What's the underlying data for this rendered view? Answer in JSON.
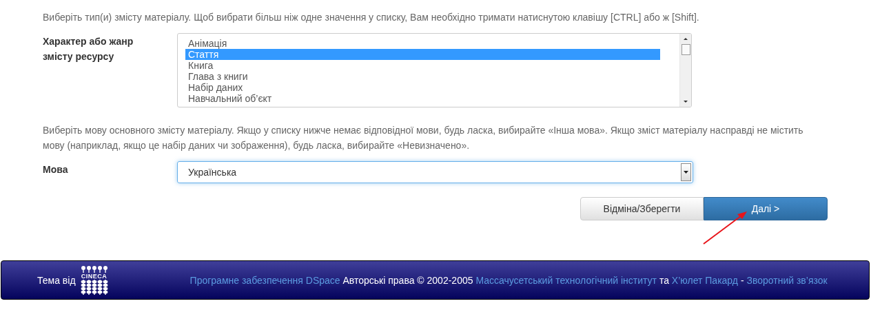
{
  "type_hint": "Виберіть тип(и) змісту матеріалу. Щоб вибрати більш ніж одне значення у списку, Вам необхідно тримати натиснутою клавішу [CTRL] або ж [Shift].",
  "genre_field": {
    "label": "Характер або жанр змісту ресурсу",
    "options": [
      {
        "label": "Анімація",
        "selected": false
      },
      {
        "label": "Стаття",
        "selected": true
      },
      {
        "label": "Книга",
        "selected": false
      },
      {
        "label": "Глава з книги",
        "selected": false
      },
      {
        "label": "Набір даних",
        "selected": false
      },
      {
        "label": "Навчальний об’єкт",
        "selected": false
      }
    ]
  },
  "language_hint": "Виберіть мову основного змісту матеріалу. Якщо у списку нижче немає відповідної мови, будь ласка, вибирайте «Інша мова». Якщо зміст матеріалу насправді не містить мову (наприклад, якщо це набір даних чи зображення), будь ласка, вибирайте «Невизначено».",
  "language_field": {
    "label": "Мова",
    "value": "Українська"
  },
  "buttons": [
    {
      "label": "Відміна/Зберегти",
      "kind": "default"
    },
    {
      "label": "Далі >",
      "kind": "primary"
    }
  ],
  "footer": {
    "theme_label": "Тема від",
    "logo_text": "CINECA",
    "parts": [
      {
        "text": "Програмне забезпечення DSpace",
        "kind": "link"
      },
      {
        "text": "Авторські права © 2002-2005",
        "kind": "text"
      },
      {
        "text": "Массачусетський технологічний інститут",
        "kind": "link"
      },
      {
        "text": "та",
        "kind": "text"
      },
      {
        "text": "Х’юлет Пакард",
        "kind": "link"
      },
      {
        "text": "-",
        "kind": "text"
      },
      {
        "text": "Зворотний зв’язок",
        "kind": "link"
      }
    ]
  }
}
